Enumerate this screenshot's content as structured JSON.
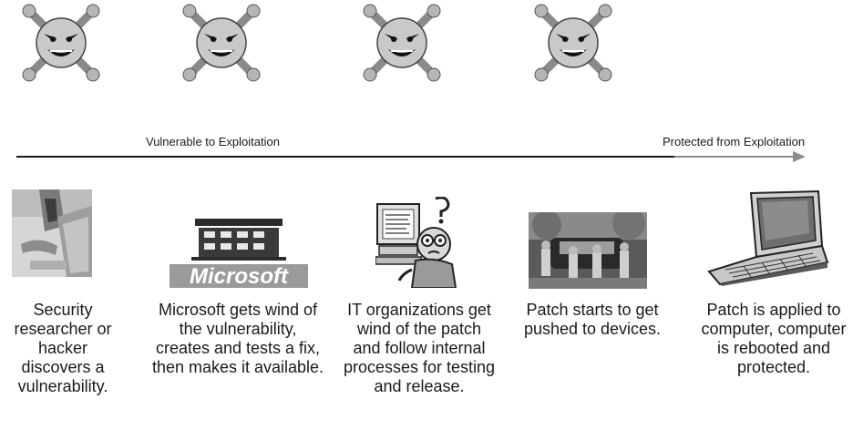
{
  "timeline": {
    "vulnerable_label": "Vulnerable to Exploitation",
    "protected_label": "Protected from Exploitation"
  },
  "stages": [
    {
      "caption": "Security researcher or hacker discovers a vulnerability.",
      "illustration": "person-at-desk-photo",
      "threat_icon": "skull-crossbones-icon"
    },
    {
      "caption": "Microsoft gets wind of the vulnerability, creates and tests a fix, then makes it available.",
      "illustration": "microsoft-building-logo",
      "logo_text": "Microsoft",
      "threat_icon": "skull-crossbones-icon"
    },
    {
      "caption": "IT organizations get wind of the patch and follow internal processes for testing and release.",
      "illustration": "confused-it-worker-cartoon",
      "threat_icon": "skull-crossbones-icon"
    },
    {
      "caption": "Patch starts to get pushed to devices.",
      "illustration": "people-pushing-car-photo",
      "threat_icon": "skull-crossbones-icon"
    },
    {
      "caption": "Patch is applied to computer, computer is rebooted and protected.",
      "illustration": "laptop-computer"
    }
  ]
}
